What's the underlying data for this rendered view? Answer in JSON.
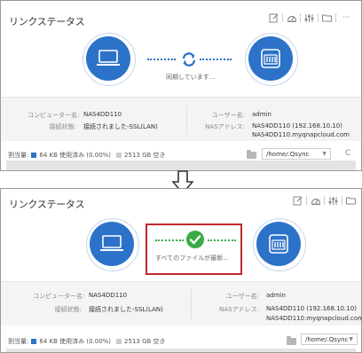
{
  "top": {
    "title": "リンクステータス",
    "status_text": "同期しています...",
    "computer_name_label": "コンピューター名:",
    "computer_name": "NAS4DD110",
    "connection_label": "接続状態:",
    "connection_value": "接続されました-SSL(LAN)",
    "user_label": "ユーザー名:",
    "user_value": "admin",
    "nas_label": "NASアドレス:",
    "nas_value1": "NAS4DD110 (192.168.10.10)",
    "nas_value2": "NAS4DD110.myqnapcloud.com",
    "quota_label": "割当量:",
    "quota_used": "64 KB 使用済み (0.00%)",
    "quota_free": "2513  GB 空き",
    "path": "/home/.Qsync",
    "refresh_glyph": "C",
    "more_glyph": "···"
  },
  "bottom": {
    "title": "リンクステータス",
    "status_text": "すべてのファイルが最新...",
    "computer_name_label": "コンピューター名:",
    "computer_name": "NAS4DD110",
    "connection_label": "接続状態:",
    "connection_value": "接続されました-SSL(LAN)",
    "user_label": "ユーザー名:",
    "user_value": "admin",
    "nas_label": "NASアドレス:",
    "nas_value1": "NAS4DD110 (192.168.10.10)",
    "nas_value2": "NAS4DD110.myqnapcloud.com",
    "quota_label": "割当量:",
    "quota_used": "64 KB 使用済み (0.00%)",
    "quota_free": "2513  GB 空き",
    "path": "/home/.Qsync"
  },
  "colors": {
    "accent_blue": "#2c72c9",
    "sync_green": "#3aaa47",
    "highlight_red": "#c0282d"
  },
  "icons": [
    "edit-icon",
    "dashboard-icon",
    "settings-sliders-icon",
    "folder-icon",
    "more-icon",
    "laptop-icon",
    "nas-device-icon",
    "sync-icon",
    "check-icon",
    "down-arrow-icon"
  ]
}
